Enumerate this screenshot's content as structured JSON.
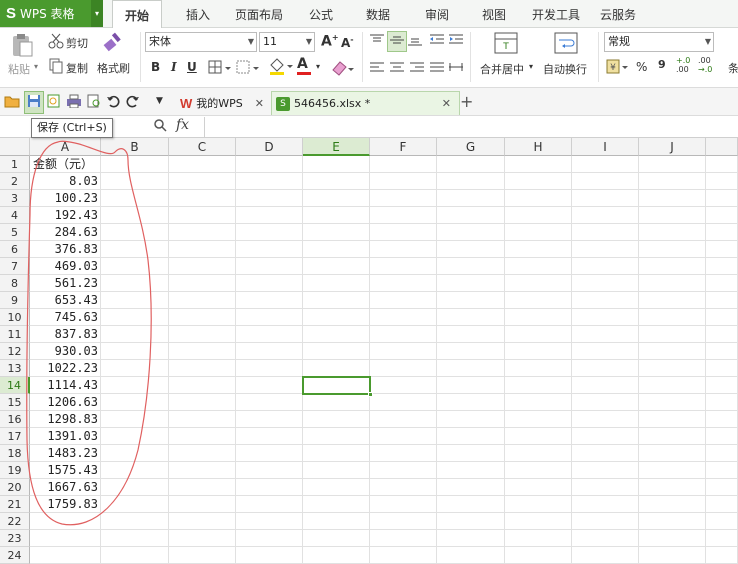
{
  "app": {
    "name": "WPS 表格",
    "logo_letter": "S"
  },
  "menu_tabs": [
    "开始",
    "插入",
    "页面布局",
    "公式",
    "数据",
    "审阅",
    "视图",
    "开发工具",
    "云服务"
  ],
  "ribbon": {
    "paste": "粘贴",
    "cut": "剪切",
    "copy": "复制",
    "format_painter": "格式刷",
    "font_name": "宋体",
    "font_size": "11",
    "merge_center": "合并居中",
    "wrap_text": "自动换行",
    "number_format": "常规",
    "percent": "%",
    "comma": "9",
    "inc_decimal": "+.0\n.00",
    "dec_decimal": ".00\n→.0",
    "bold": "B",
    "italic": "I",
    "underline": "U",
    "font_color_letter": "A"
  },
  "quick_access": {
    "tab_mywps": "我的WPS",
    "tab_file": "546456.xlsx *",
    "tooltip": "保存 (Ctrl+S)",
    "fx": "fx"
  },
  "sheet": {
    "columns": [
      "A",
      "B",
      "C",
      "D",
      "E",
      "F",
      "G",
      "H",
      "I",
      "J"
    ],
    "selected_column": "E",
    "selected_row": "14",
    "rows": [
      "1",
      "2",
      "3",
      "4",
      "5",
      "6",
      "7",
      "8",
      "9",
      "10",
      "11",
      "12",
      "13",
      "14",
      "15",
      "16",
      "17",
      "18",
      "19",
      "20",
      "21",
      "22",
      "23",
      "24"
    ],
    "col_a": [
      "金额（元）",
      "8.03",
      "100.23",
      "192.43",
      "284.63",
      "376.83",
      "469.03",
      "561.23",
      "653.43",
      "745.63",
      "837.83",
      "930.03",
      "1022.23",
      "1114.43",
      "1206.63",
      "1298.83",
      "1391.03",
      "1483.23",
      "1575.43",
      "1667.63",
      "1759.83",
      "",
      "",
      ""
    ]
  },
  "colors": {
    "brand": "#4a9a2e",
    "annotation": "#e06060"
  }
}
